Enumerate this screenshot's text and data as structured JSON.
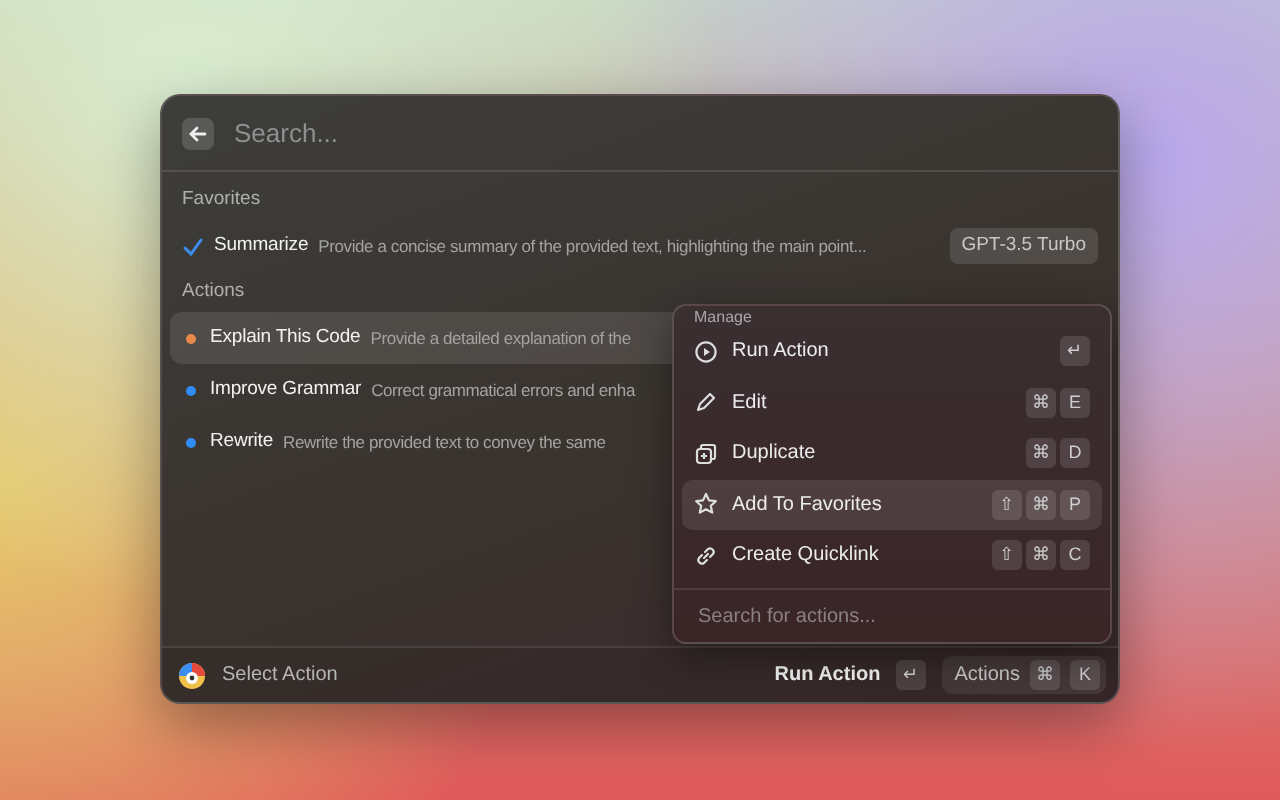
{
  "search": {
    "placeholder": "Search..."
  },
  "sections": [
    {
      "title": "Favorites",
      "items": [
        {
          "kind": "favorite",
          "title": "Summarize",
          "description": "Provide a concise summary of the provided text, highlighting the main point...",
          "tag": "GPT-3.5 Turbo",
          "selected": false
        }
      ]
    },
    {
      "title": "Actions",
      "items": [
        {
          "kind": "dot",
          "color": "#e8894a",
          "title": "Explain This Code",
          "description": "Provide a detailed explanation of the",
          "selected": true
        },
        {
          "kind": "dot",
          "color": "#2f8cf5",
          "title": "Improve Grammar",
          "description": "Correct grammatical errors and enha",
          "selected": false
        },
        {
          "kind": "dot",
          "color": "#2f8cf5",
          "title": "Rewrite",
          "description": "Rewrite the provided text to convey the same",
          "selected": false
        }
      ]
    }
  ],
  "menu": {
    "section": "Manage",
    "items": [
      {
        "label": "Run Action",
        "keys": [
          "↵"
        ],
        "selected": false
      },
      {
        "label": "Edit",
        "keys": [
          "⌘",
          "E"
        ],
        "selected": false
      },
      {
        "label": "Duplicate",
        "keys": [
          "⌘",
          "D"
        ],
        "selected": false
      },
      {
        "label": "Add To Favorites",
        "keys": [
          "⇧",
          "⌘",
          "P"
        ],
        "selected": true
      },
      {
        "label": "Create Quicklink",
        "keys": [
          "⇧",
          "⌘",
          "C"
        ],
        "selected": false
      }
    ],
    "search_placeholder": "Search for actions..."
  },
  "footer": {
    "title": "Select Action",
    "primary": {
      "label": "Run Action",
      "keys": [
        "↵"
      ]
    },
    "actions": {
      "label": "Actions",
      "keys": [
        "⌘",
        "K"
      ]
    }
  }
}
